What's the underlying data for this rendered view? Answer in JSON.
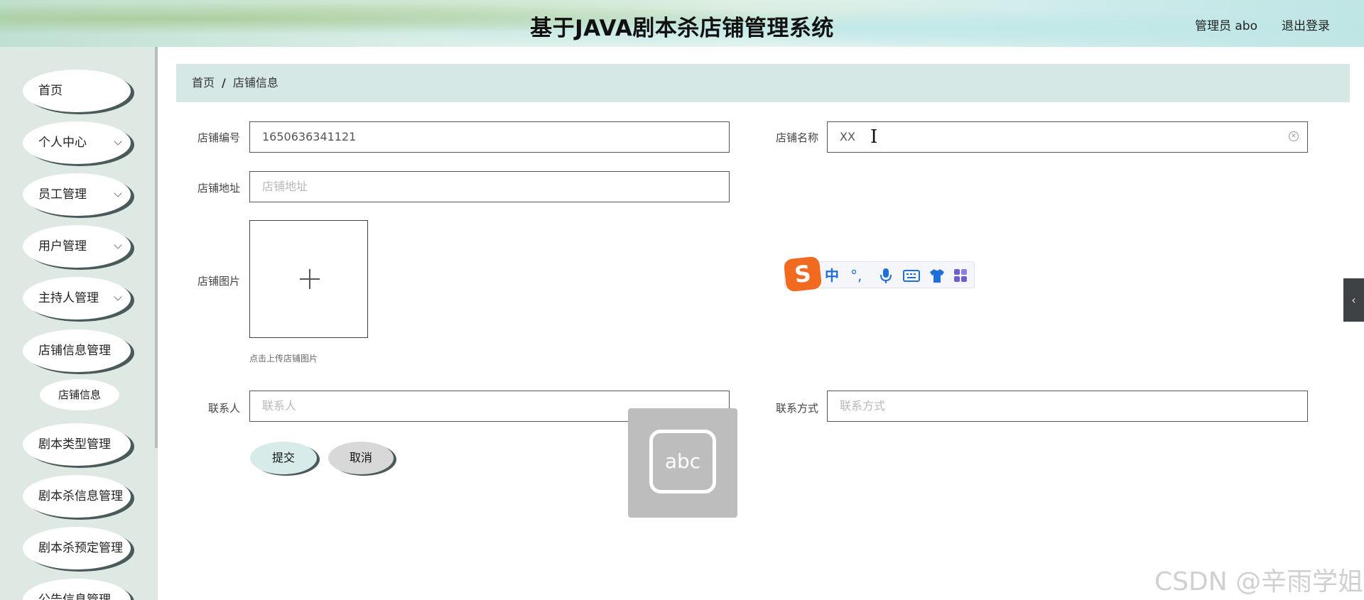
{
  "header": {
    "title": "基于JAVA剧本杀店铺管理系统",
    "user": "管理员 abo",
    "logout": "退出登录"
  },
  "sidebar": {
    "items": [
      {
        "label": "首页",
        "has_submenu": false
      },
      {
        "label": "个人中心",
        "has_submenu": true
      },
      {
        "label": "员工管理",
        "has_submenu": true
      },
      {
        "label": "用户管理",
        "has_submenu": true
      },
      {
        "label": "主持人管理",
        "has_submenu": true
      },
      {
        "label": "店铺信息管理",
        "has_submenu": true
      },
      {
        "label": "剧本类型管理",
        "has_submenu": true
      },
      {
        "label": "剧本杀信息管理",
        "has_submenu": true
      },
      {
        "label": "剧本杀预定管理",
        "has_submenu": true
      },
      {
        "label": "公告信息管理",
        "has_submenu": true
      }
    ],
    "active_sub": "店铺信息"
  },
  "breadcrumb": {
    "home": "首页",
    "separator": "/",
    "current": "店铺信息"
  },
  "form": {
    "store_id": {
      "label": "店铺编号",
      "value": "1650636341121"
    },
    "store_name": {
      "label": "店铺名称",
      "value": "XX"
    },
    "store_address": {
      "label": "店铺地址",
      "placeholder": "店铺地址"
    },
    "store_image": {
      "label": "店铺图片",
      "hint": "点击上传店铺图片"
    },
    "contact_person": {
      "label": "联系人",
      "placeholder": "联系人"
    },
    "contact_method": {
      "label": "联系方式",
      "placeholder": "联系方式"
    },
    "submit": "提交",
    "cancel": "取消"
  },
  "ime_toolbar": {
    "logo": "S",
    "mode": "中",
    "punct": "°,",
    "icons": [
      "mic-icon",
      "keyboard-icon",
      "shirt-icon",
      "grid-icon"
    ]
  },
  "abc_widget": {
    "label": "abc"
  },
  "watermark": "CSDN @辛雨学姐",
  "colors": {
    "sidebar_bg": "#dfe9e4",
    "breadcrumb_bg": "#d5e8e6",
    "submit_bg": "#d7ecea",
    "cancel_bg": "#d8d8d8",
    "ime_blue": "#1e6fd9",
    "ime_orange": "#f06a1f"
  }
}
